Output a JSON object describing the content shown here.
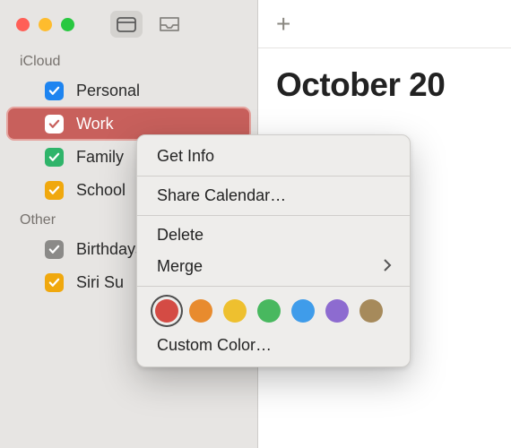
{
  "traffic_lights": {
    "close": "#ff5f57",
    "min": "#febc2e",
    "max": "#28c840"
  },
  "sidebar": {
    "sections": [
      {
        "title": "iCloud",
        "items": [
          {
            "label": "Personal",
            "color": "#1e84f0",
            "selected": false
          },
          {
            "label": "Work",
            "color": "#ffffff",
            "bg": "#c8605c",
            "selected": true
          },
          {
            "label": "Family",
            "color": "#2fb46a",
            "selected": false
          },
          {
            "label": "School",
            "color": "#f0a80e",
            "selected": false
          }
        ]
      },
      {
        "title": "Other",
        "items": [
          {
            "label": "Birthdays",
            "color": "#8b8a88",
            "selected": false
          },
          {
            "label": "Siri Suggestions",
            "color": "#f0a80e",
            "selected": false,
            "display": "Siri Su"
          }
        ]
      }
    ]
  },
  "main": {
    "title": "October 20",
    "plus": "+"
  },
  "context_menu": {
    "get_info": "Get Info",
    "share": "Share Calendar…",
    "delete": "Delete",
    "merge": "Merge",
    "custom_color": "Custom Color…",
    "colors": [
      "#d44b44",
      "#e88b2e",
      "#eec02f",
      "#48b85f",
      "#3f9cea",
      "#8d6bd0",
      "#a68a5b"
    ],
    "current_color_index": 0
  }
}
